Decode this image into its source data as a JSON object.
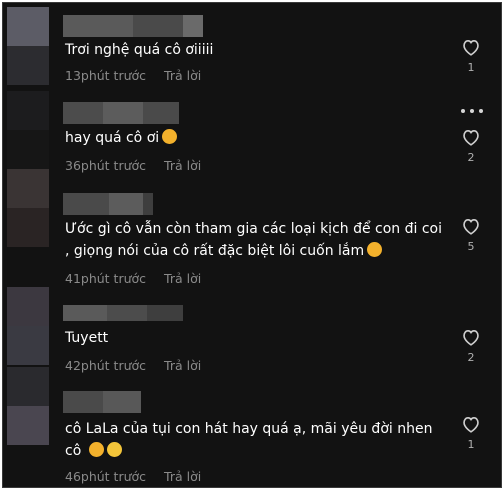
{
  "comments": [
    {
      "text": "Trơi nghệ quá cô ơiiiii",
      "time": "13phút trước",
      "reply": "Trả lời",
      "likes": "1"
    },
    {
      "text": "hay quá cô ơi",
      "emoji": "🥰",
      "time": "36phút trước",
      "reply": "Trả lời",
      "likes": "2"
    },
    {
      "text": "Ước gì cô vẫn còn tham gia các loại kịch để con đi coi\n, giọng nói của cô rất đặc biệt lôi cuốn lắm",
      "emoji": "🥰",
      "time": "41phút trước",
      "reply": "Trả lời",
      "likes": "5"
    },
    {
      "text": "Tuyett",
      "time": "42phút trước",
      "reply": "Trả lời",
      "likes": "2"
    },
    {
      "text": "cô LaLa của tụi con hát hay quá ạ, mãi yêu đời nhen\ncô",
      "emoji": "🥰 😁",
      "time": "46phút trước",
      "reply": "Trả lời",
      "likes": "1"
    }
  ],
  "icons": {
    "like": "heart-outline-icon",
    "more": "more-dots-icon"
  },
  "colors": {
    "background": "#121212",
    "text": "#ffffff",
    "meta": "#8a8a8a"
  }
}
